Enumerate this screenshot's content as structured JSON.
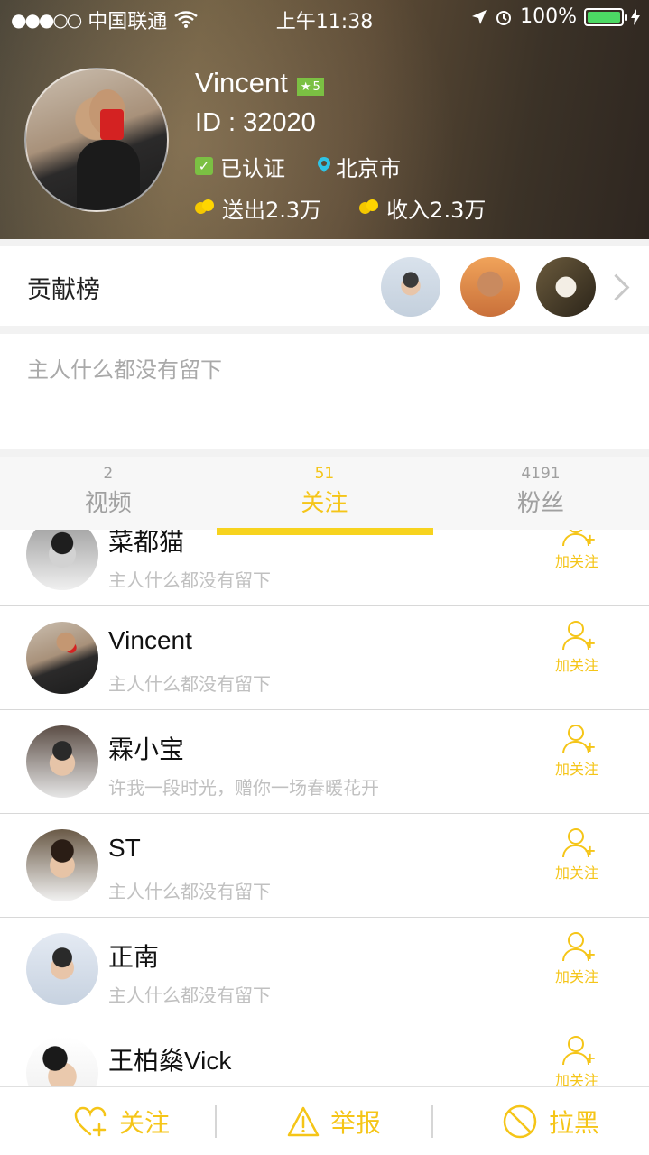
{
  "status_bar": {
    "carrier": "中国联通",
    "time": "上午11:38",
    "battery": "100%"
  },
  "profile": {
    "name": "Vincent",
    "level": "5",
    "id_text": "ID : 32020",
    "verified": "已认证",
    "city": "北京市",
    "sent": "送出2.3万",
    "received": "收入2.3万"
  },
  "contribution": {
    "label": "贡献榜"
  },
  "bio": {
    "text": "主人什么都没有留下"
  },
  "tabs": [
    {
      "count": "2",
      "label": "视频"
    },
    {
      "count": "51",
      "label": "关注"
    },
    {
      "count": "4191",
      "label": "粉丝"
    }
  ],
  "list": [
    {
      "name": "菜都猫",
      "bio": "主人什么都没有留下",
      "action": "加关注"
    },
    {
      "name": "Vincent",
      "bio": "主人什么都没有留下",
      "action": "加关注"
    },
    {
      "name": "霖小宝",
      "bio": "许我一段时光，赠你一场春暖花开",
      "action": "加关注"
    },
    {
      "name": "ST",
      "bio": "主人什么都没有留下",
      "action": "加关注"
    },
    {
      "name": " 正南",
      "bio": "主人什么都没有留下",
      "action": "加关注"
    },
    {
      "name": "王柏燊Vick",
      "bio": "",
      "action": "加关注"
    }
  ],
  "bottom_bar": {
    "follow": "关注",
    "report": "举报",
    "block": "拉黑"
  },
  "colors": {
    "accent": "#f5c518",
    "level_badge": "#7bc043",
    "location_pin": "#2ec4e6"
  }
}
